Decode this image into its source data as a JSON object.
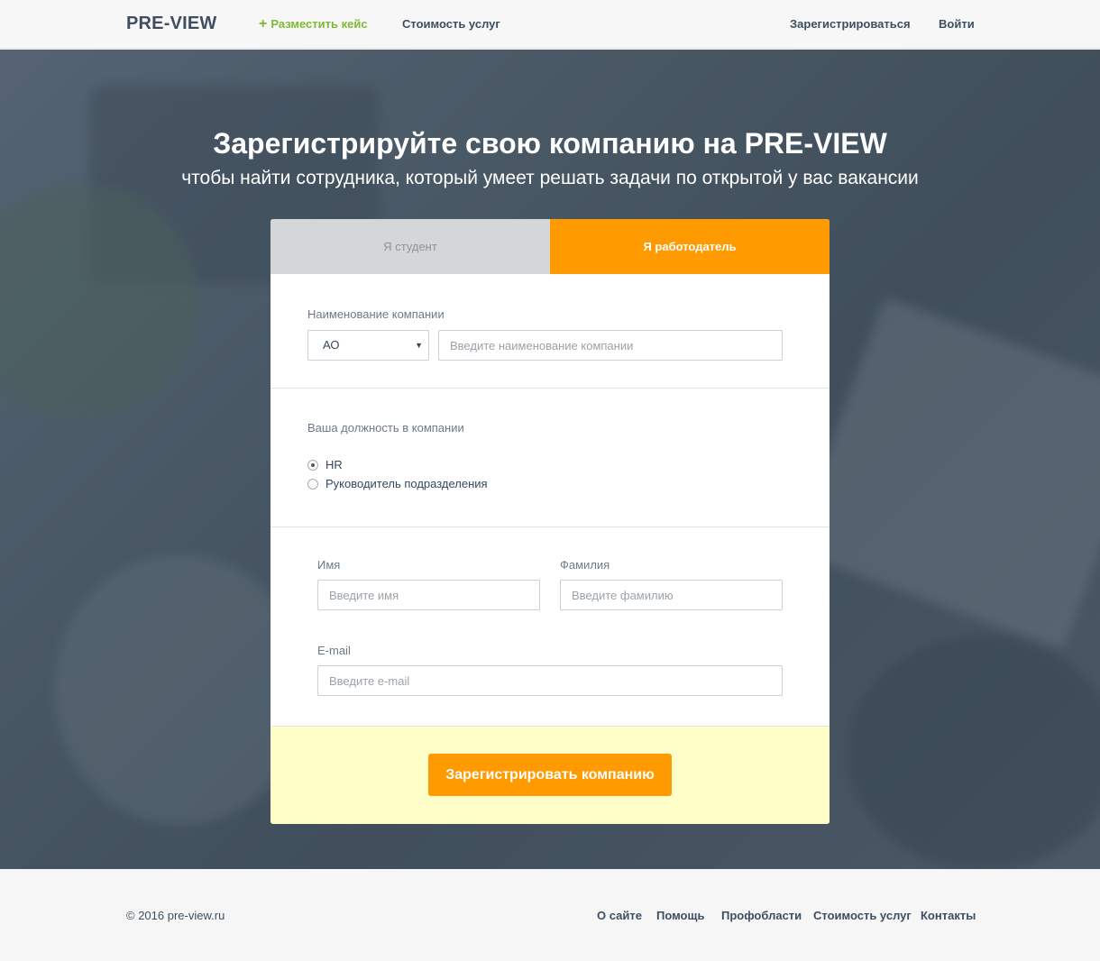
{
  "header": {
    "logo": "PRE-VIEW",
    "post_case": "Разместить кейс",
    "pricing": "Стоимость услуг",
    "register": "Зарегистрироваться",
    "login": "Войти"
  },
  "hero": {
    "title": "Зарегистрируйте свою компанию на PRE-VIEW",
    "subtitle": "чтобы найти сотрудника, который умеет решать задачи по открытой у вас вакансии"
  },
  "tabs": {
    "student": "Я студент",
    "employer": "Я работодатель",
    "active": "employer"
  },
  "company": {
    "label": "Наименование компании",
    "type_value": "АО",
    "name_placeholder": "Введите наименование компании"
  },
  "position": {
    "label": "Ваша должность в компании",
    "options": [
      "HR",
      "Руководитель подразделения"
    ],
    "selected": "HR"
  },
  "person": {
    "first_name_label": "Имя",
    "first_name_placeholder": "Введите имя",
    "last_name_label": "Фамилия",
    "last_name_placeholder": "Введите фамилию",
    "email_label": "E-mail",
    "email_placeholder": "Введите e-mail"
  },
  "submit_label": "Зарегистрировать компанию",
  "footer": {
    "copyright": "© 2016 pre-view.ru",
    "links": [
      "О сайте",
      "Помощь",
      "Профобласти",
      "Стоимость услуг",
      "Контакты"
    ]
  },
  "colors": {
    "accent": "#ff9a00",
    "green": "#7dba32",
    "text": "#3e4e60",
    "submit_band": "#fffdc8"
  }
}
